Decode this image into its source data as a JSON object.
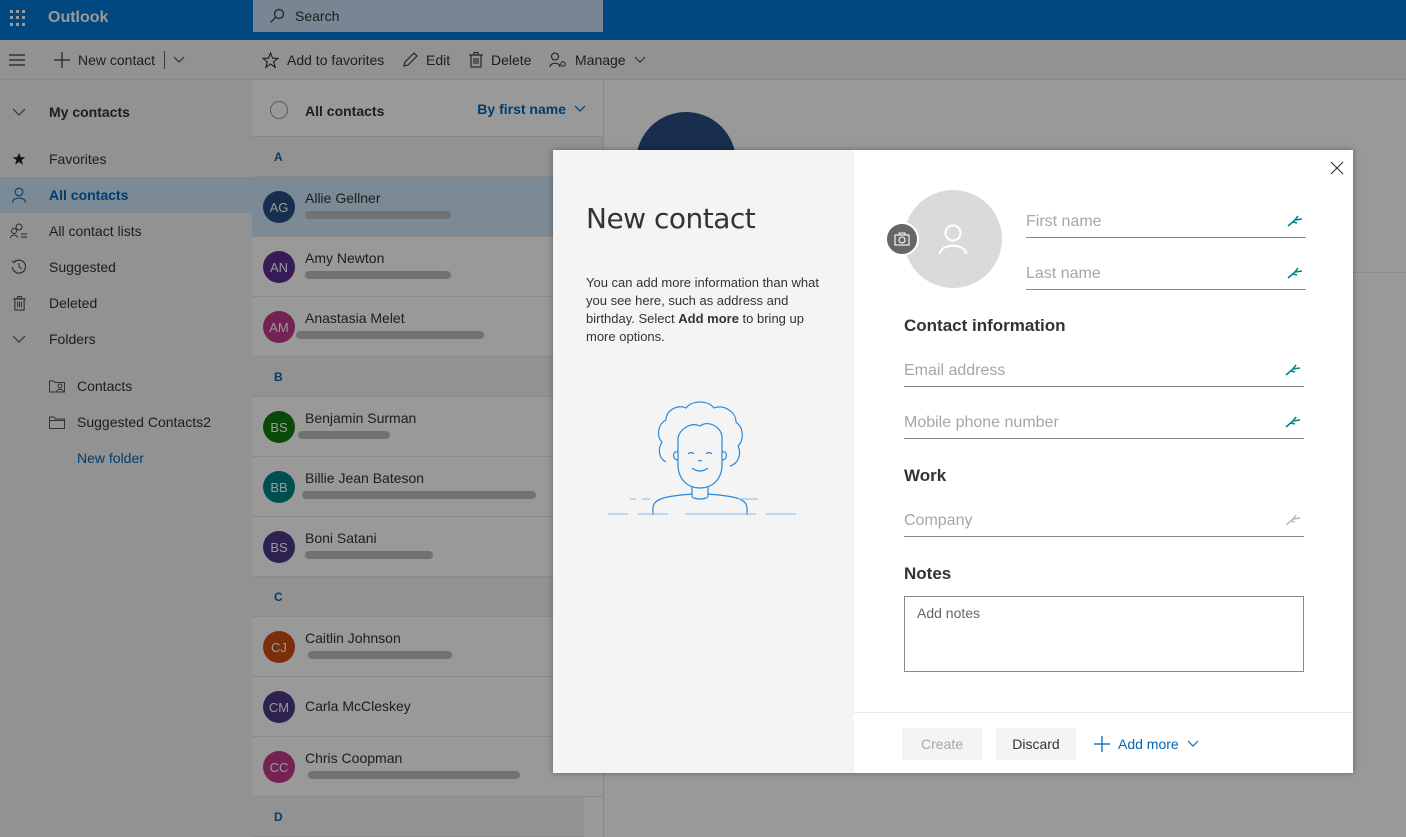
{
  "app": {
    "title": "Outlook",
    "search_placeholder": "Search"
  },
  "toolbar": {
    "new_contact": "New contact",
    "add_to_favorites": "Add to favorites",
    "edit": "Edit",
    "delete": "Delete",
    "manage": "Manage"
  },
  "sidebar": {
    "my_contacts": "My contacts",
    "items": [
      {
        "label": "Favorites",
        "icon": "star-icon"
      },
      {
        "label": "All contacts",
        "icon": "person-icon",
        "active": true
      },
      {
        "label": "All contact lists",
        "icon": "contact-list-icon"
      },
      {
        "label": "Suggested",
        "icon": "history-icon"
      },
      {
        "label": "Deleted",
        "icon": "trash-icon"
      }
    ],
    "folders_label": "Folders",
    "folders": [
      {
        "label": "Contacts",
        "icon": "contacts-folder-icon"
      },
      {
        "label": "Suggested Contacts2",
        "icon": "folder-icon"
      }
    ],
    "new_folder": "New folder"
  },
  "list": {
    "title": "All contacts",
    "sort": "By first name",
    "groups": [
      {
        "letter": "A",
        "contacts": [
          {
            "initials": "AG",
            "name": "Allie Gellner",
            "color": "#2b4b84",
            "email_redacted": true,
            "selected": true
          },
          {
            "initials": "AN",
            "name": "Amy Newton",
            "color": "#5c2e91",
            "email_redacted": true
          },
          {
            "initials": "AM",
            "name": "Anastasia Melet",
            "color": "#c2398a",
            "email_redacted": true
          }
        ]
      },
      {
        "letter": "B",
        "contacts": [
          {
            "initials": "BS",
            "name": "Benjamin Surman",
            "color": "#107c10",
            "email_redacted": true
          },
          {
            "initials": "BB",
            "name": "Billie Jean Bateson",
            "color": "#038387",
            "email_redacted": true
          },
          {
            "initials": "BS",
            "name": "Boni Satani",
            "color": "#4b3a87",
            "email_redacted": true
          }
        ]
      },
      {
        "letter": "C",
        "contacts": [
          {
            "initials": "CJ",
            "name": "Caitlin Johnson",
            "color": "#ca5010",
            "email_redacted": true
          },
          {
            "initials": "CM",
            "name": "Carla McCleskey",
            "color": "#4b3a87",
            "email_redacted": false
          },
          {
            "initials": "CC",
            "name": "Chris Coopman",
            "color": "#c2398a",
            "email_redacted": true
          }
        ]
      },
      {
        "letter": "D",
        "contacts": []
      }
    ]
  },
  "modal": {
    "title": "New contact",
    "desc_before": "You can add more information than what you see here, such as address and birthday. Select ",
    "desc_bold": "Add more",
    "desc_after": " to bring up more options.",
    "first_name_placeholder": "First name",
    "last_name_placeholder": "Last name",
    "contact_info_heading": "Contact information",
    "email_placeholder": "Email address",
    "mobile_placeholder": "Mobile phone number",
    "work_heading": "Work",
    "company_placeholder": "Company",
    "notes_heading": "Notes",
    "notes_placeholder": "Add notes",
    "create": "Create",
    "discard": "Discard",
    "add_more": "Add more"
  },
  "colors": {
    "brand": "#0078d4",
    "link": "#0067b8",
    "pin_accent": "#038387"
  }
}
